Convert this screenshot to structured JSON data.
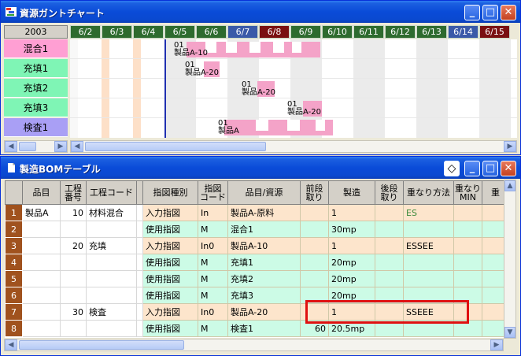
{
  "gantt_window": {
    "title": "資源ガントチャート",
    "year": "2003",
    "dates": [
      "6/2",
      "6/3",
      "6/4",
      "6/5",
      "6/6",
      "6/7",
      "6/8",
      "6/9",
      "6/10",
      "6/11",
      "6/12",
      "6/13",
      "6/14",
      "6/15"
    ],
    "resources": [
      {
        "label": "混合1",
        "color": "#ff9fd3"
      },
      {
        "label": "充填1",
        "color": "#7ff5b5"
      },
      {
        "label": "充填2",
        "color": "#7ff5b5"
      },
      {
        "label": "充填3",
        "color": "#7ff5b5"
      },
      {
        "label": "検査1",
        "color": "#a99ff5"
      }
    ],
    "tasks": [
      {
        "code": "01",
        "name": "製品A-10"
      },
      {
        "code": "01",
        "name": "製品A-20"
      },
      {
        "code": "01",
        "name": "製品A-20"
      },
      {
        "code": "01",
        "name": "製品A-20"
      },
      {
        "code": "01",
        "name": "製品A"
      }
    ]
  },
  "bom_window": {
    "title": "製造BOMテーブル",
    "headers": {
      "item": "品目",
      "step_no": "工程\n番号",
      "step_code": "工程コード",
      "inst_type": "指図種別",
      "inst_code": "指図\nコード",
      "item_res": "品目/資源",
      "pre": "前段\n取り",
      "mfg": "製造",
      "post": "後段\n取り",
      "overlap": "重なり方法",
      "overlap_min": "重なり\nMIN",
      "extra": "重"
    },
    "rows": [
      {
        "num": "1",
        "item": "製品A",
        "step_no": "10",
        "step_code": "材料混合",
        "inst_type": "入力指図",
        "inst_code": "In",
        "item_res": "製品A-原料",
        "pre": "",
        "mfg": "1",
        "post": "",
        "overlap": "ES",
        "overlap_min": ""
      },
      {
        "num": "2",
        "item": "",
        "step_no": "",
        "step_code": "",
        "inst_type": "使用指図",
        "inst_code": "M",
        "item_res": "混合1",
        "pre": "",
        "mfg": "30mp",
        "post": "",
        "overlap": "",
        "overlap_min": ""
      },
      {
        "num": "3",
        "item": "",
        "step_no": "20",
        "step_code": "充填",
        "inst_type": "入力指図",
        "inst_code": "In0",
        "item_res": "製品A-10",
        "pre": "",
        "mfg": "1",
        "post": "",
        "overlap": "ESSEE",
        "overlap_min": ""
      },
      {
        "num": "4",
        "item": "",
        "step_no": "",
        "step_code": "",
        "inst_type": "使用指図",
        "inst_code": "M",
        "item_res": "充填1",
        "pre": "",
        "mfg": "20mp",
        "post": "",
        "overlap": "",
        "overlap_min": ""
      },
      {
        "num": "5",
        "item": "",
        "step_no": "",
        "step_code": "",
        "inst_type": "使用指図",
        "inst_code": "M",
        "item_res": "充填2",
        "pre": "",
        "mfg": "20mp",
        "post": "",
        "overlap": "",
        "overlap_min": ""
      },
      {
        "num": "6",
        "item": "",
        "step_no": "",
        "step_code": "",
        "inst_type": "使用指図",
        "inst_code": "M",
        "item_res": "充填3",
        "pre": "",
        "mfg": "20mp",
        "post": "",
        "overlap": "",
        "overlap_min": ""
      },
      {
        "num": "7",
        "item": "",
        "step_no": "30",
        "step_code": "検査",
        "inst_type": "入力指図",
        "inst_code": "In0",
        "item_res": "製品A-20",
        "pre": "",
        "mfg": "1",
        "post": "",
        "overlap": "SSEEE",
        "overlap_min": ""
      },
      {
        "num": "8",
        "item": "",
        "step_no": "",
        "step_code": "",
        "inst_type": "使用指図",
        "inst_code": "M",
        "item_res": "検査1",
        "pre": "60",
        "mfg": "20.5mp",
        "post": "",
        "overlap": "",
        "overlap_min": ""
      }
    ]
  }
}
